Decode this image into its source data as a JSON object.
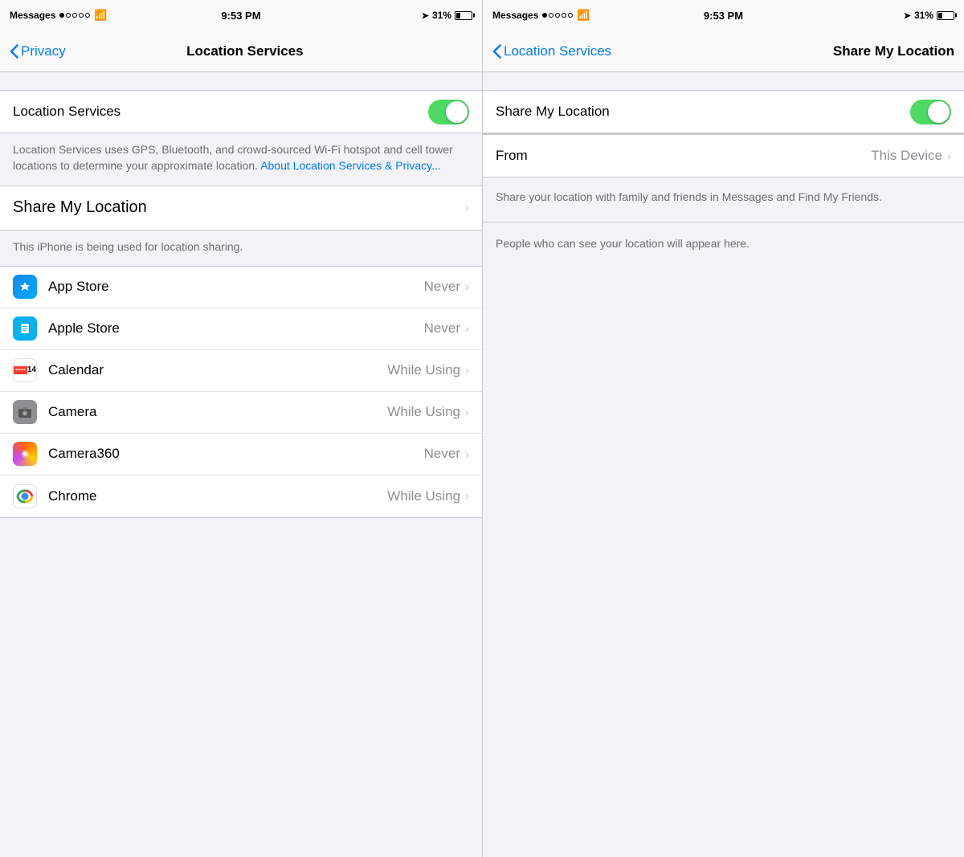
{
  "left_panel": {
    "status": {
      "carrier": "Messages",
      "time": "9:53 PM",
      "battery_pct": 31
    },
    "nav": {
      "back_label": "Privacy",
      "title": "Location Services"
    },
    "location_services": {
      "label": "Location Services",
      "toggle_on": true
    },
    "description": "Location Services uses GPS, Bluetooth, and crowd-sourced Wi-Fi hotspot and cell tower locations to determine your approximate location.",
    "link_text": "About Location Services & Privacy...",
    "share_my_location": {
      "label": "Share My Location"
    },
    "iphone_desc": "This iPhone is being used for location sharing.",
    "apps": [
      {
        "name": "App Store",
        "permission": "Never",
        "icon": "appstore"
      },
      {
        "name": "Apple Store",
        "permission": "Never",
        "icon": "applestore"
      },
      {
        "name": "Calendar",
        "permission": "While Using",
        "icon": "calendar"
      },
      {
        "name": "Camera",
        "permission": "While Using",
        "icon": "camera"
      },
      {
        "name": "Camera360",
        "permission": "Never",
        "icon": "camera360"
      },
      {
        "name": "Chrome",
        "permission": "While Using",
        "icon": "chrome"
      }
    ]
  },
  "right_panel": {
    "status": {
      "carrier": "Messages",
      "time": "9:53 PM",
      "battery_pct": 31
    },
    "nav": {
      "back_label": "Location Services",
      "title": "Share My Location"
    },
    "share_my_location": {
      "label": "Share My Location",
      "toggle_on": true
    },
    "from": {
      "label": "From",
      "value": "This Device"
    },
    "description1": "Share your location with family and friends in Messages and Find My Friends.",
    "description2": "People who can see your location will appear here."
  }
}
